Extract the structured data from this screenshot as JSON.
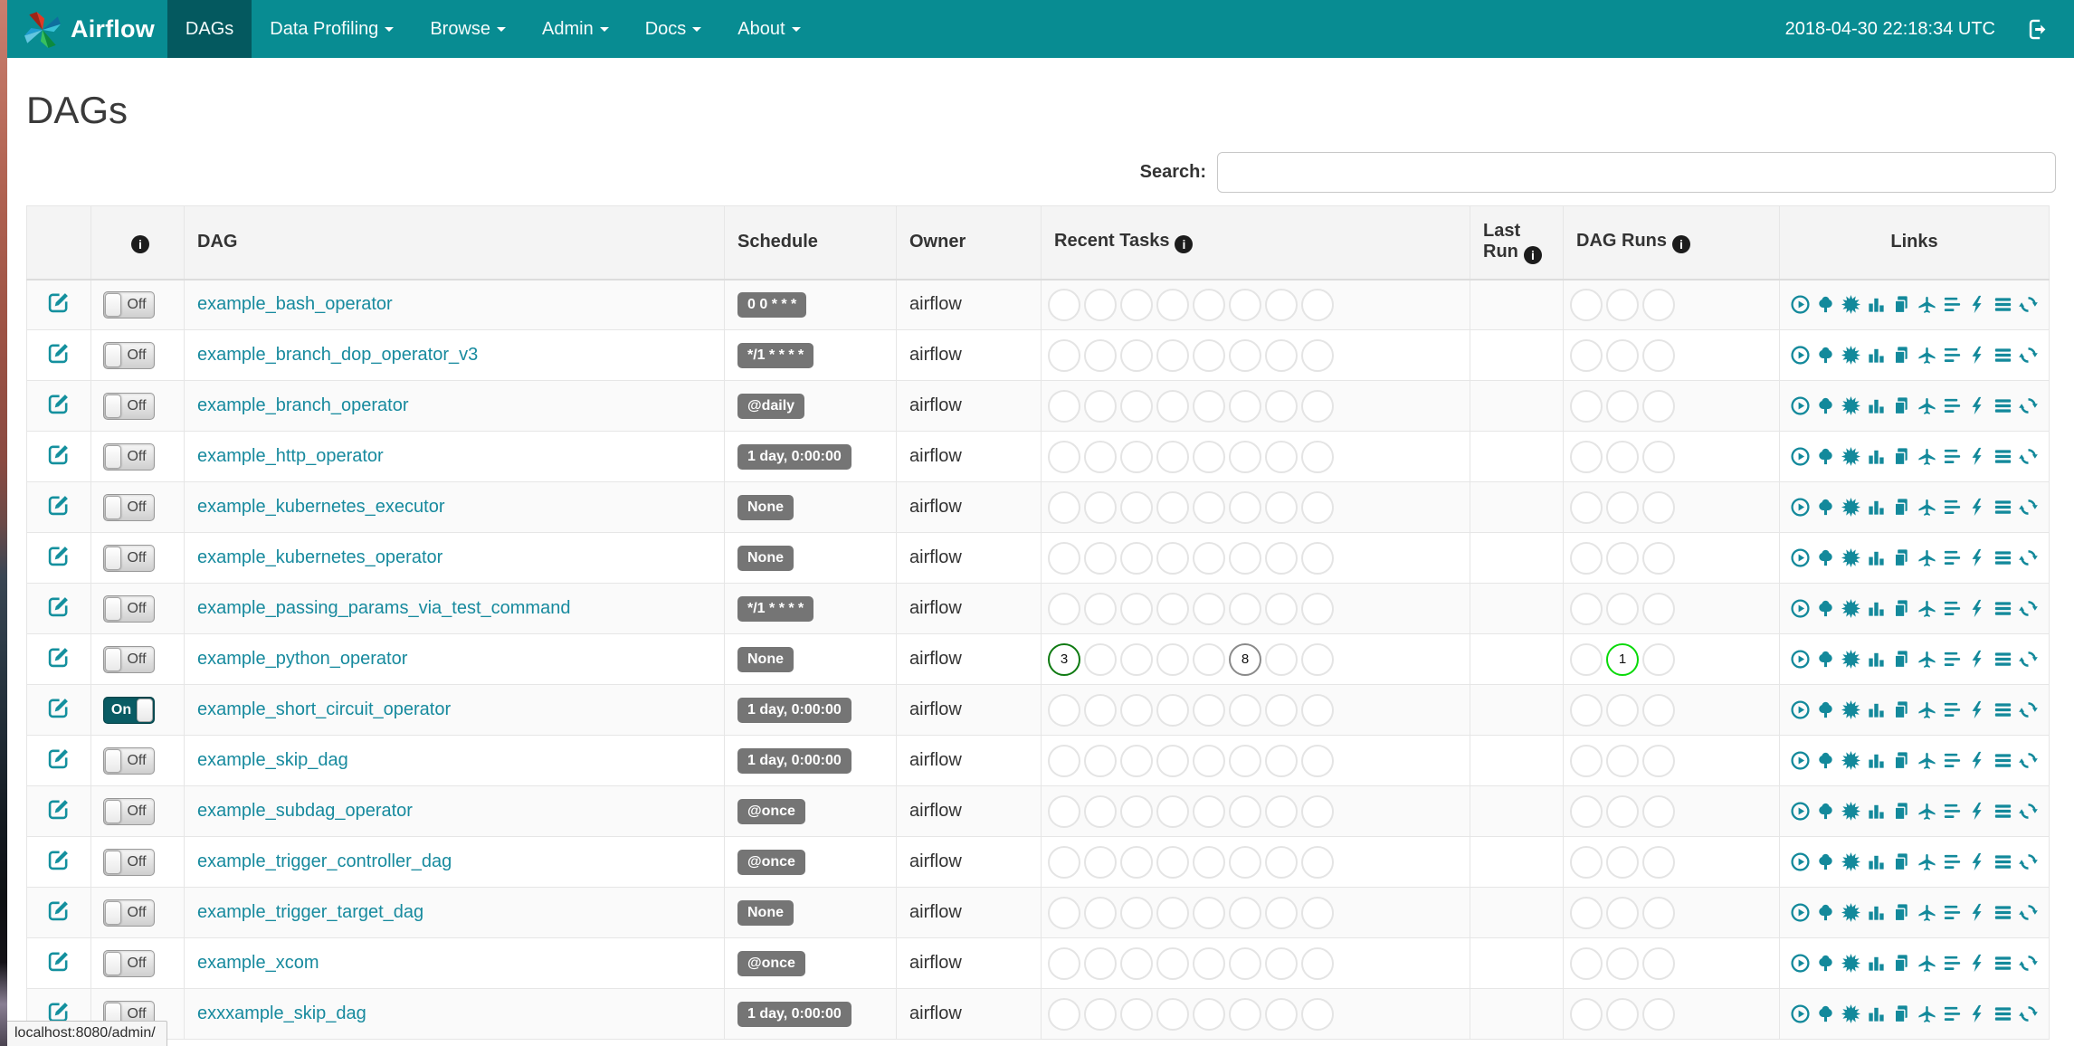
{
  "navbar": {
    "brand": "Airflow",
    "items": [
      {
        "label": "DAGs",
        "active": true,
        "caret": false
      },
      {
        "label": "Data Profiling",
        "active": false,
        "caret": true
      },
      {
        "label": "Browse",
        "active": false,
        "caret": true
      },
      {
        "label": "Admin",
        "active": false,
        "caret": true
      },
      {
        "label": "Docs",
        "active": false,
        "caret": true
      },
      {
        "label": "About",
        "active": false,
        "caret": true
      }
    ],
    "clock": "2018-04-30 22:18:34 UTC"
  },
  "page": {
    "title": "DAGs",
    "search_label": "Search:",
    "search_value": "",
    "status_bar": "localhost:8080/admin/"
  },
  "toggle_labels": {
    "on": "On",
    "off": "Off"
  },
  "table": {
    "headers": {
      "dag": "DAG",
      "schedule": "Schedule",
      "owner": "Owner",
      "recent_tasks": "Recent Tasks",
      "last_run": "Last Run",
      "dag_runs": "DAG Runs",
      "links": "Links"
    },
    "recent_tasks_slots": 8,
    "dag_runs_slots": 3,
    "links_icons": [
      "trigger-dag",
      "tree-view",
      "graph-view",
      "task-duration",
      "task-tries",
      "landing-times",
      "gantt",
      "code-view",
      "dag-details",
      "refresh"
    ],
    "rows": [
      {
        "name": "example_bash_operator",
        "schedule": "0 0 * * *",
        "owner": "airflow",
        "enabled": false,
        "recent_tasks": [],
        "dag_runs": [],
        "last_run": ""
      },
      {
        "name": "example_branch_dop_operator_v3",
        "schedule": "*/1 * * * *",
        "owner": "airflow",
        "enabled": false,
        "recent_tasks": [],
        "dag_runs": [],
        "last_run": ""
      },
      {
        "name": "example_branch_operator",
        "schedule": "@daily",
        "owner": "airflow",
        "enabled": false,
        "recent_tasks": [],
        "dag_runs": [],
        "last_run": ""
      },
      {
        "name": "example_http_operator",
        "schedule": "1 day, 0:00:00",
        "owner": "airflow",
        "enabled": false,
        "recent_tasks": [],
        "dag_runs": [],
        "last_run": ""
      },
      {
        "name": "example_kubernetes_executor",
        "schedule": "None",
        "owner": "airflow",
        "enabled": false,
        "recent_tasks": [],
        "dag_runs": [],
        "last_run": ""
      },
      {
        "name": "example_kubernetes_operator",
        "schedule": "None",
        "owner": "airflow",
        "enabled": false,
        "recent_tasks": [],
        "dag_runs": [],
        "last_run": ""
      },
      {
        "name": "example_passing_params_via_test_command",
        "schedule": "*/1 * * * *",
        "owner": "airflow",
        "enabled": false,
        "recent_tasks": [],
        "dag_runs": [],
        "last_run": ""
      },
      {
        "name": "example_python_operator",
        "schedule": "None",
        "owner": "airflow",
        "enabled": false,
        "recent_tasks": [
          {
            "slot": 0,
            "count": "3",
            "state": "success"
          },
          {
            "slot": 5,
            "count": "8",
            "state": "queued"
          }
        ],
        "dag_runs": [
          {
            "slot": 1,
            "count": "1",
            "state": "running"
          }
        ],
        "last_run": ""
      },
      {
        "name": "example_short_circuit_operator",
        "schedule": "1 day, 0:00:00",
        "owner": "airflow",
        "enabled": true,
        "recent_tasks": [],
        "dag_runs": [],
        "last_run": ""
      },
      {
        "name": "example_skip_dag",
        "schedule": "1 day, 0:00:00",
        "owner": "airflow",
        "enabled": false,
        "recent_tasks": [],
        "dag_runs": [],
        "last_run": ""
      },
      {
        "name": "example_subdag_operator",
        "schedule": "@once",
        "owner": "airflow",
        "enabled": false,
        "recent_tasks": [],
        "dag_runs": [],
        "last_run": ""
      },
      {
        "name": "example_trigger_controller_dag",
        "schedule": "@once",
        "owner": "airflow",
        "enabled": false,
        "recent_tasks": [],
        "dag_runs": [],
        "last_run": ""
      },
      {
        "name": "example_trigger_target_dag",
        "schedule": "None",
        "owner": "airflow",
        "enabled": false,
        "recent_tasks": [],
        "dag_runs": [],
        "last_run": ""
      },
      {
        "name": "example_xcom",
        "schedule": "@once",
        "owner": "airflow",
        "enabled": false,
        "recent_tasks": [],
        "dag_runs": [],
        "last_run": ""
      },
      {
        "name": "exxxample_skip_dag",
        "schedule": "1 day, 0:00:00",
        "owner": "airflow",
        "enabled": false,
        "recent_tasks": [],
        "dag_runs": [],
        "last_run": ""
      }
    ]
  },
  "colors": {
    "navbar_bg": "#088c92",
    "navbar_active_bg": "#04595f",
    "link_teal": "#178a9e",
    "icon_teal": "#13899b",
    "badge_bg": "#757575",
    "toggle_on_bg": "#0a5c64",
    "circle_empty_border": "#e4e4e4",
    "states": {
      "success": "#0f7a12",
      "queued": "#8a8a8a",
      "running": "#09d909"
    }
  }
}
